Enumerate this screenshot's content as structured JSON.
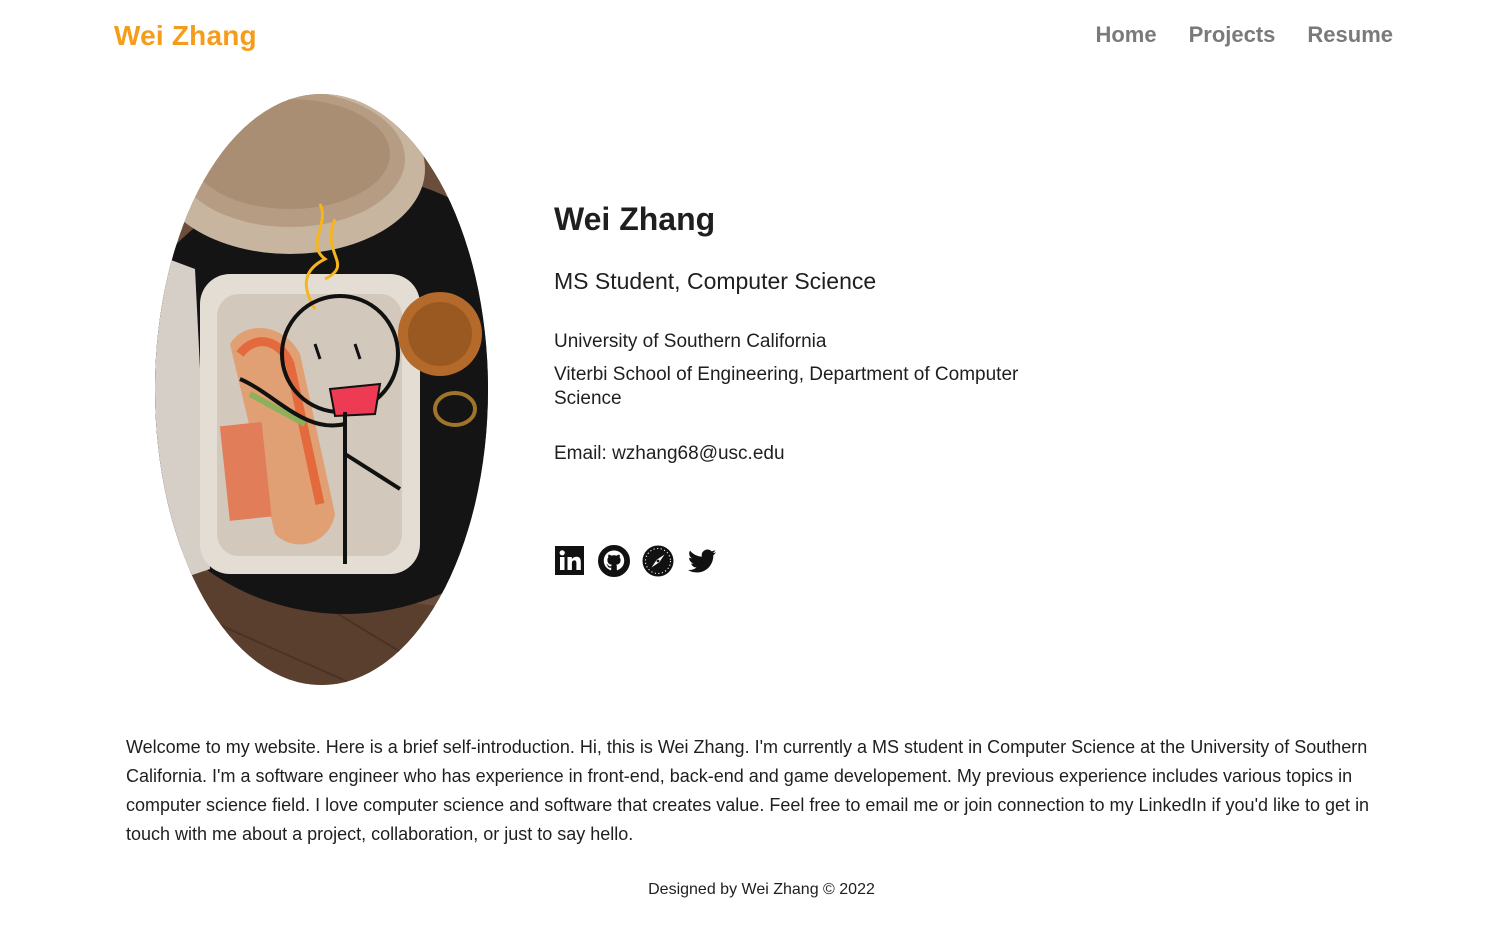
{
  "brand": {
    "name": "Wei Zhang",
    "color": "#f59c1a"
  },
  "nav": {
    "items": [
      {
        "label": "Home"
      },
      {
        "label": "Projects"
      },
      {
        "label": "Resume"
      }
    ]
  },
  "profile": {
    "photo_icon": "profile-photo",
    "name": "Wei Zhang",
    "title": "MS Student, Computer Science",
    "university": "University of Southern California",
    "department": "Viterbi School of Engineering, Department of Computer Science",
    "email": "Email: wzhang68@usc.edu"
  },
  "social": {
    "icons": [
      "linkedin-icon",
      "github-icon",
      "compass-icon",
      "twitter-icon"
    ]
  },
  "intro": {
    "text": "Welcome to my website. Here is a brief self-introduction. Hi, this is Wei Zhang. I'm currently a MS student in Computer Science at the University of Southern California. I'm a software engineer who has experience in front-end, back-end and game developement. My previous experience includes various topics in computer science field. I love computer science and software that creates value. Feel free to email me or join connection to my LinkedIn if you'd like to get in touch with me about a project, collaboration, or just to say hello."
  },
  "footer": {
    "text": "Designed by Wei Zhang © 2022"
  }
}
